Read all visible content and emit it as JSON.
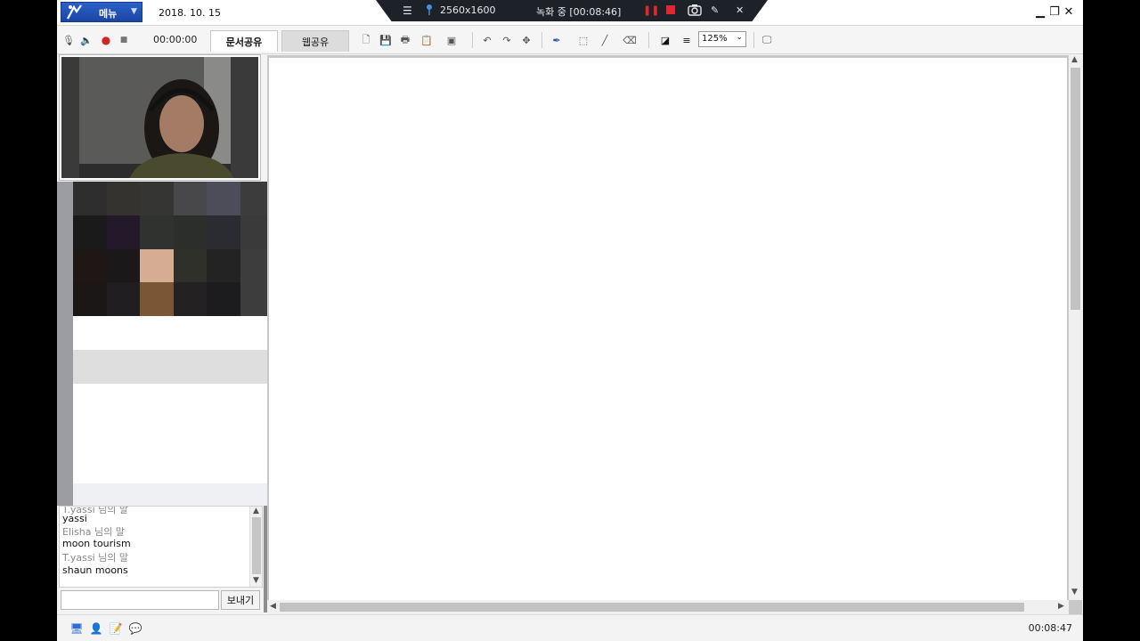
{
  "window": {
    "menu_label": "메뉴",
    "date": "2018. 10. 15",
    "controls": {
      "minimize": "▁",
      "restore": "❐",
      "close": "✕"
    }
  },
  "recording_bar": {
    "resolution": "2560x1600",
    "status": "녹화 중 [00:08:46]"
  },
  "toolbar": {
    "timer": "00:00:00",
    "tab_document": "문서공유",
    "tab_web": "웹공유",
    "zoom": "125%"
  },
  "chat": {
    "lines": [
      {
        "text": "T.yassi 님의 말",
        "kind": "who"
      },
      {
        "text": "yassi",
        "kind": "msg"
      },
      {
        "text": "Elisha 님의 말",
        "kind": "who"
      },
      {
        "text": "moon tourism",
        "kind": "msg"
      },
      {
        "text": "T.yassi 님의 말",
        "kind": "who"
      },
      {
        "text": "shaun moons",
        "kind": "msg"
      }
    ],
    "input_value": "",
    "send_label": "보내기"
  },
  "status_bar": {
    "time": "00:08:47"
  },
  "colors": {
    "menu_blue": "#1f4bb0",
    "rec_red": "#e0262e",
    "rec_bar": "#1d2128"
  },
  "icons": [
    "mic-icon",
    "speaker-icon",
    "record-icon",
    "stop-icon",
    "new-doc-icon",
    "save-icon",
    "print-icon",
    "copy-icon",
    "capture-icon",
    "undo-icon",
    "redo-icon",
    "move-icon",
    "pen-icon",
    "select-icon",
    "line-icon",
    "eraser-icon",
    "color-icon",
    "line-width-icon",
    "monitor-icon",
    "pin-icon",
    "pause-icon",
    "camera-icon",
    "edit-icon",
    "user-icon",
    "notes-icon",
    "chat-icon"
  ]
}
